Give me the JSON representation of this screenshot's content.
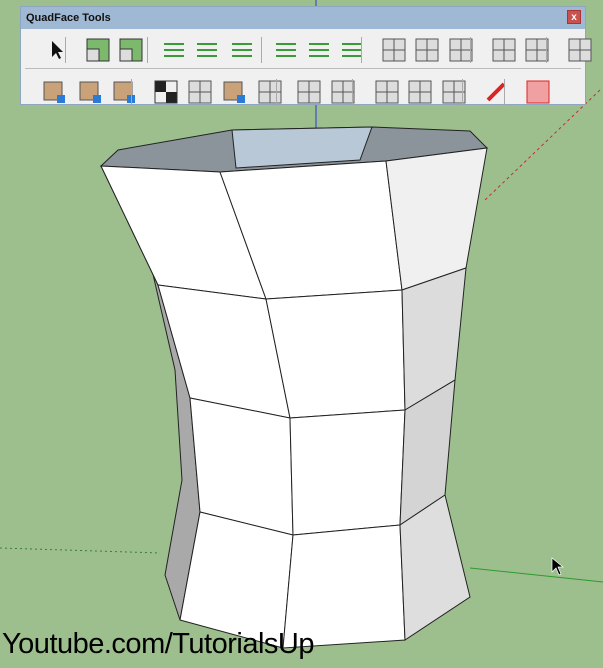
{
  "toolbar": {
    "title": "QuadFace Tools",
    "close_label": "x",
    "row1": [
      "select-icon",
      "grow-selection-icon",
      "shrink-selection-icon",
      "select-ring-icon",
      "grow-ring-icon",
      "shrink-ring-icon",
      "select-loop-icon",
      "grow-loop-icon",
      "shrink-loop-icon",
      "connect-edges-icon",
      "insert-loops-icon",
      "remove-loops-icon",
      "build-corner-icon",
      "build-end-icon",
      "flip-edge-icon"
    ],
    "row2": [
      "uv-map-icon",
      "uv-texture-icon",
      "unwrap-mesh-icon",
      "checker-icon",
      "copy-uv-icon",
      "uv-mapping-icon",
      "wrap-icon",
      "offset-loop-icon",
      "quad-grid-icon",
      "insert-loop-icon",
      "remove-loop-icon",
      "build-corner-loop-icon",
      "pencil-icon",
      "make-planar-icon"
    ]
  },
  "watermark": "Youtube.com/TutorialsUp"
}
